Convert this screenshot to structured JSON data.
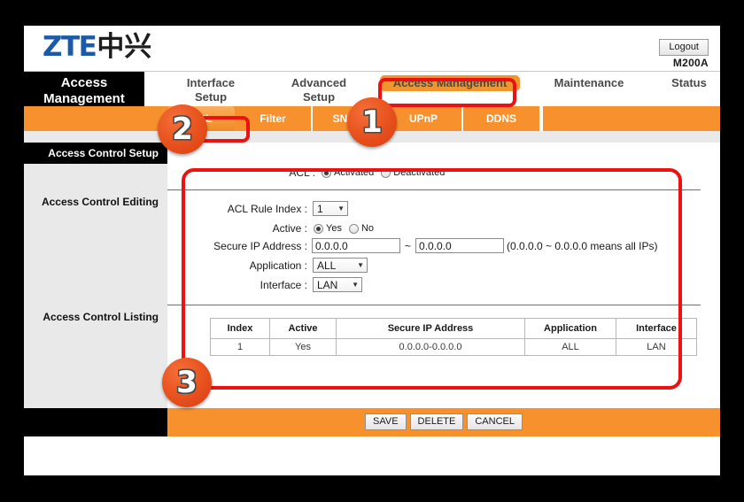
{
  "header": {
    "logo_zte": "ZTE",
    "logo_cn": "中兴",
    "logout_label": "Logout",
    "model": "M200A"
  },
  "mainnav": {
    "brand": "Access Management",
    "items": [
      {
        "label": "Interface\nSetup",
        "active": false
      },
      {
        "label": "Advanced\nSetup",
        "active": false
      },
      {
        "label": "Access Management",
        "active": true
      },
      {
        "label": "Maintenance",
        "active": false
      },
      {
        "label": "Status",
        "active": false
      }
    ]
  },
  "subnav": {
    "items": [
      {
        "label": "ACL",
        "active": true
      },
      {
        "label": "Filter",
        "active": false
      },
      {
        "label": "SNMP",
        "active": false
      },
      {
        "label": "UPnP",
        "active": false
      },
      {
        "label": "DDNS",
        "active": false
      }
    ]
  },
  "sidebar": {
    "title": "Access Control Setup",
    "editing": "Access Control Editing",
    "listing": "Access Control Listing"
  },
  "form": {
    "acl_label": "ACL :",
    "acl_activated": "Activated",
    "acl_deactivated": "Deactivated",
    "acl_value": "Activated",
    "rule_index_label": "ACL Rule Index :",
    "rule_index_value": "1",
    "active_label": "Active :",
    "active_yes": "Yes",
    "active_no": "No",
    "active_value": "Yes",
    "secure_ip_label": "Secure IP Address :",
    "secure_ip_from": "0.0.0.0",
    "secure_ip_tilde": "~",
    "secure_ip_to": "0.0.0.0",
    "secure_ip_hint": "(0.0.0.0 ~ 0.0.0.0 means all IPs)",
    "application_label": "Application :",
    "application_value": "ALL",
    "interface_label": "Interface :",
    "interface_value": "LAN"
  },
  "table": {
    "headers": [
      "Index",
      "Active",
      "Secure IP Address",
      "Application",
      "Interface"
    ],
    "rows": [
      [
        "1",
        "Yes",
        "0.0.0.0-0.0.0.0",
        "ALL",
        "LAN"
      ]
    ]
  },
  "footer": {
    "save": "SAVE",
    "delete": "DELETE",
    "cancel": "CANCEL"
  },
  "annotations": {
    "markers": [
      "1",
      "2",
      "3"
    ]
  },
  "colors": {
    "orange": "#f6912d",
    "orange_tab": "#f0962f",
    "highlight_red": "#ee1111",
    "brand_blue": "#1b5aa8",
    "black": "#000000"
  }
}
